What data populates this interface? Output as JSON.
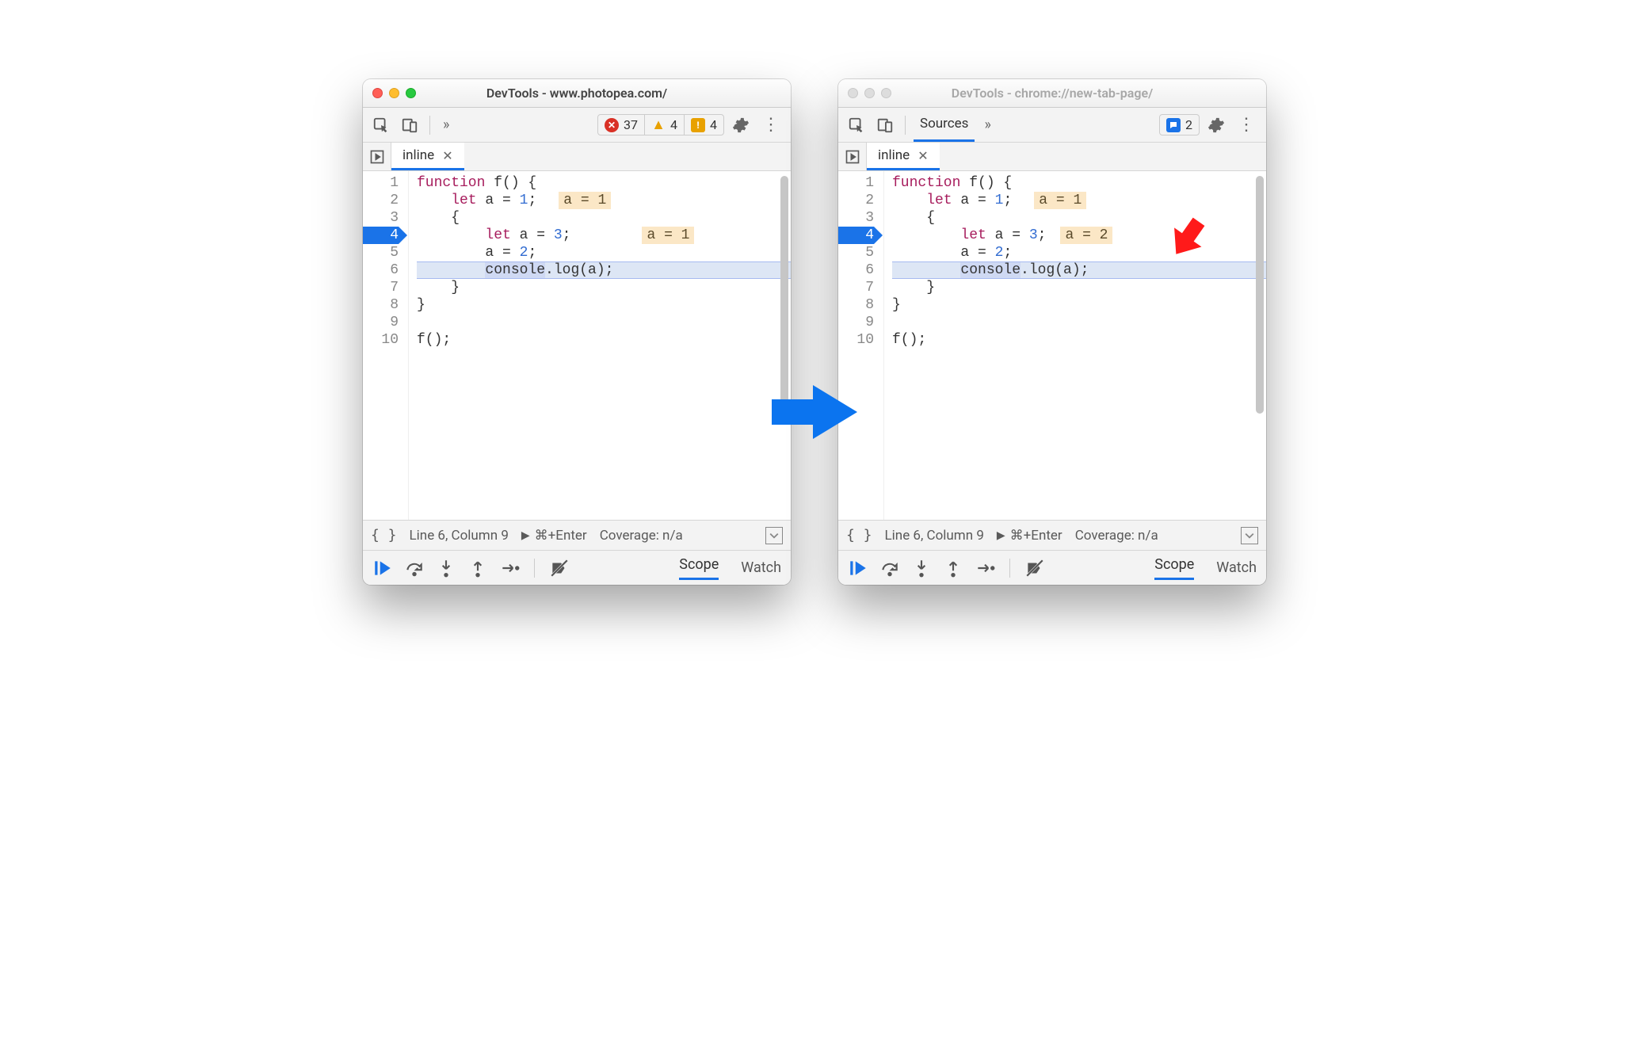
{
  "left": {
    "active": true,
    "title": "DevTools - www.photopea.com/",
    "badges": {
      "errors": "37",
      "warnings": "4",
      "messages": "4"
    },
    "file_tab": "inline",
    "gutter": [
      "1",
      "2",
      "3",
      "4",
      "5",
      "6",
      "7",
      "8",
      "9",
      "10"
    ],
    "exec_line_index": 3,
    "highlight_line_index": 5,
    "code": {
      "l1": {
        "a": "function",
        "b": " f() {"
      },
      "l2": {
        "a": "    let",
        "b": " a = ",
        "c": "1",
        "d": ";",
        "hint": "a = 1"
      },
      "l3": "    {",
      "l4": {
        "a": "        let",
        "b": " a = ",
        "c": "3",
        "d": ";",
        "hint": "a = 1"
      },
      "l5": {
        "a": "        a = ",
        "b": "2",
        "c": ";"
      },
      "l6": {
        "a": "        ",
        "sel": "console",
        "b": ".log(a);"
      },
      "l7": "    }",
      "l8": "}",
      "l9": "",
      "l10": "f();"
    },
    "status": {
      "pos": "Line 6, Column 9",
      "run": "⌘+Enter",
      "coverage": "Coverage: n/a"
    },
    "debug_tabs": {
      "scope": "Scope",
      "watch": "Watch"
    }
  },
  "right": {
    "active": false,
    "title": "DevTools - chrome://new-tab-page/",
    "tab_panel": "Sources",
    "badges": {
      "messages": "2"
    },
    "file_tab": "inline",
    "gutter": [
      "1",
      "2",
      "3",
      "4",
      "5",
      "6",
      "7",
      "8",
      "9",
      "10"
    ],
    "exec_line_index": 3,
    "highlight_line_index": 5,
    "code": {
      "l1": {
        "a": "function",
        "b": " f() {"
      },
      "l2": {
        "a": "    let",
        "b": " a = ",
        "c": "1",
        "d": ";",
        "hint": "a = 1"
      },
      "l3": "    {",
      "l4": {
        "a": "        let",
        "b": " a = ",
        "c": "3",
        "d": ";",
        "hint": "a = 2"
      },
      "l5": {
        "a": "        a = ",
        "b": "2",
        "c": ";"
      },
      "l6": {
        "a": "        ",
        "sel": "console",
        "b": ".log(a);"
      },
      "l7": "    }",
      "l8": "}",
      "l9": "",
      "l10": "f();"
    },
    "status": {
      "pos": "Line 6, Column 9",
      "run": "⌘+Enter",
      "coverage": "Coverage: n/a"
    },
    "debug_tabs": {
      "scope": "Scope",
      "watch": "Watch"
    }
  }
}
